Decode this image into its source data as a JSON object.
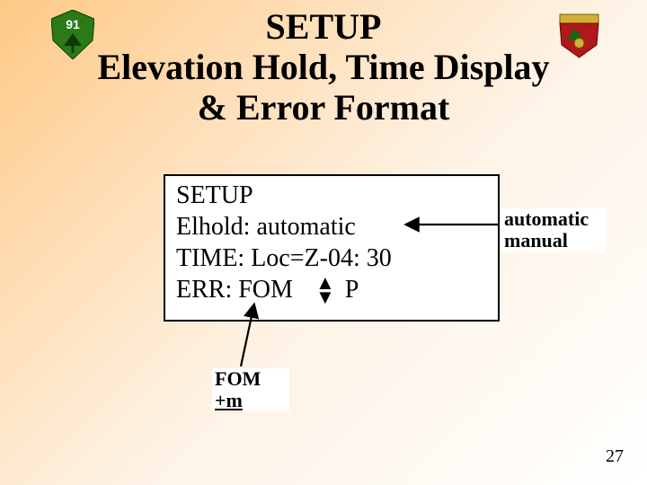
{
  "badges": {
    "leftNumber": "91"
  },
  "title": {
    "line1": "SETUP",
    "line2": "Elevation Hold, Time Display",
    "line3": "& Error Format"
  },
  "display": {
    "row1": "SETUP",
    "row2": "Elhold: automatic",
    "row3": "TIME: Loc=Z-04: 30",
    "row4_left": "ERR: FOM",
    "row4_right": "P"
  },
  "noteRight": {
    "line1": "automatic",
    "line2": "manual"
  },
  "noteBottom": {
    "line1": "FOM",
    "line2": "+m"
  },
  "pageNumber": "27"
}
